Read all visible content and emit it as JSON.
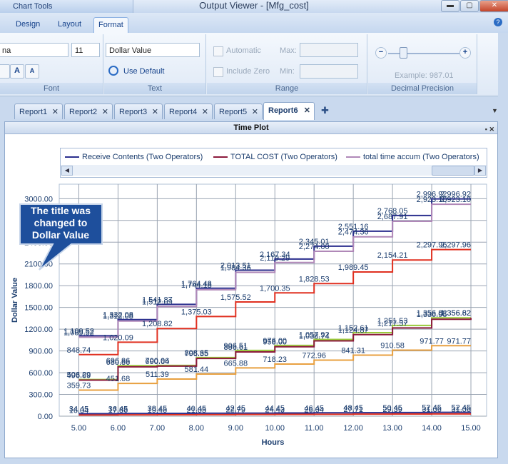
{
  "window": {
    "context_tab": "Chart Tools",
    "title": "Output Viewer - [Mfg_cost]",
    "controls": {
      "minimize": "▬",
      "maximize": "▢",
      "close": "✕"
    }
  },
  "ribbon": {
    "tabs": [
      {
        "label": "Design"
      },
      {
        "label": "Layout"
      },
      {
        "label": "Format"
      }
    ],
    "help": "?",
    "font_group": {
      "label": "Font",
      "font_name": "na",
      "font_size": "11",
      "grow": "A",
      "shrink": "A"
    },
    "text_group": {
      "label": "Text",
      "title_value": "Dollar Value",
      "use_default": "Use Default"
    },
    "range_group": {
      "label": "Range",
      "automatic": "Automatic",
      "include_zero": "Include Zero",
      "max_label": "Max:",
      "min_label": "Min:"
    },
    "precision_group": {
      "label": "Decimal Precision",
      "example": "Example: 987.01",
      "minus": "−",
      "plus": "+"
    }
  },
  "doc_tabs": [
    {
      "label": "Report1"
    },
    {
      "label": "Report2"
    },
    {
      "label": "Report3"
    },
    {
      "label": "Report4"
    },
    {
      "label": "Report5"
    },
    {
      "label": "Report6"
    }
  ],
  "panel": {
    "title": "Time Plot"
  },
  "callout": "The title was changed to Dollar Value",
  "colors": {
    "receive": "#2b2f8e",
    "total_cost": "#8c1a3c",
    "total_time": "#b088b8",
    "red": "#e03020",
    "green": "#9acb3c",
    "orange": "#e8a040",
    "callout": "#1e4f9c"
  },
  "chart_data": {
    "type": "line",
    "step": true,
    "title": "",
    "xlabel": "Hours",
    "ylabel": "Dollar Value",
    "xlim": [
      4.5,
      15.4
    ],
    "ylim": [
      0,
      3200
    ],
    "x_ticks": [
      "5.00",
      "6.00",
      "7.00",
      "8.00",
      "9.00",
      "10.00",
      "11.00",
      "12.00",
      "13.00",
      "14.00",
      "15.00"
    ],
    "y_ticks": [
      "0.00",
      "300.00",
      "600.00",
      "900.00",
      "1200.00",
      "1500.00",
      "1800.00",
      "2100.00",
      "2400.00",
      "2700.00",
      "3000.00"
    ],
    "legend": [
      "Receive Contents (Two Operators)",
      "TOTAL COST (Two Operators)",
      "total time accum (Two Operators)"
    ],
    "x": [
      5,
      6,
      7,
      8,
      9,
      10,
      11,
      12,
      13,
      14,
      15
    ],
    "series": [
      {
        "color": "#2b2f8e",
        "values": [
          1109.52,
          1332.08,
          1541.87,
          1764.48,
          2013.51,
          2167.34,
          2345.01,
          2551.16,
          2768.05,
          2996.92,
          2996.92
        ],
        "labels": [
          "1,109.52",
          "1,332.08",
          "1,541.87",
          "1,764.48",
          "2,013.51",
          "2,167.34",
          "2,345.01",
          "2,551.16",
          "2,768.05",
          "2,996.92",
          "2,996.92"
        ]
      },
      {
        "color": "#b088b8",
        "values": [
          1089.52,
          1312.08,
          1512.09,
          1744.18,
          1984.36,
          2119.29,
          2274.0,
          2474.36,
          2687.91,
          2923.1,
          2923.1
        ],
        "labels": [
          "1,089.52",
          "1,312.08",
          "1,512.09",
          "1,744.18",
          "1,984.36",
          "2,119.29",
          "2,274.00",
          "2,474.36",
          "2,687.91",
          "2,923.10",
          "2,923.10"
        ]
      },
      {
        "color": "#e03020",
        "values": [
          848.74,
          1020.09,
          1208.82,
          1375.03,
          1575.52,
          1700.35,
          1828.53,
          1989.45,
          2154.21,
          2297.96,
          2297.96
        ],
        "labels": [
          "848.74",
          "1,020.09",
          "1,208.82",
          "1,375.03",
          "1,575.52",
          "1,700.35",
          "1,828.53",
          "1,989.45",
          "2,154.21",
          "2,297.96",
          "2,297.96"
        ]
      },
      {
        "color": "#9acb3c",
        "values": [
          506.29,
          696.86,
          700.06,
          808.65,
          906.51,
          976.0,
          1057.92,
          1152.61,
          1251.53,
          1356.82,
          1356.82
        ],
        "labels": [
          "506.29",
          "696.86",
          "700.06",
          "808.65",
          "906.51",
          "976.00",
          "1,057.92",
          "1,152.61",
          "1,251.53",
          "1,356.82",
          "1,356.82"
        ]
      },
      {
        "color": "#8c1a3c",
        "values": [
          496.69,
          680.86,
          690.64,
          796.35,
          886.61,
          958.0,
          1038.74,
          1124.87,
          1217.57,
          1336.95,
          1356.62
        ],
        "labels": [
          "496.69",
          "680.86",
          "690.64",
          "796.35",
          "886.61",
          "958.00",
          "1,038.74",
          "1,124.87",
          "1,217.57",
          "1,336.95",
          "1,356.62"
        ]
      },
      {
        "color": "#e8a040",
        "values": [
          359.73,
          451.68,
          511.39,
          581.44,
          665.88,
          718.23,
          772.96,
          841.31,
          910.58,
          971.77,
          971.77
        ],
        "labels": [
          "359.73",
          "451.68",
          "511.39",
          "581.44",
          "665.88",
          "718.23",
          "772.96",
          "841.31",
          "910.58",
          "971.77",
          "971.77"
        ]
      },
      {
        "color": "#2b2f8e",
        "values": [
          34.45,
          36.45,
          38.45,
          40.45,
          42.45,
          44.45,
          46.45,
          48.45,
          50.45,
          52.45,
          52.45
        ],
        "labels": [
          "34.45",
          "36.45",
          "38.45",
          "40.45",
          "42.45",
          "44.45",
          "46.45",
          "48.45",
          "50.45",
          "52.45",
          "52.45"
        ]
      },
      {
        "color": "#e03020",
        "values": [
          16.04,
          17.86,
          19.46,
          21.05,
          22.79,
          24.43,
          26.04,
          27.71,
          29.39,
          31.06,
          31.06
        ],
        "labels": [
          "16.04",
          "17.86",
          "19.46",
          "21.05",
          "22.79",
          "24.43",
          "26.04",
          "27.71",
          "29.39",
          "31.06",
          "31.06"
        ]
      }
    ]
  }
}
